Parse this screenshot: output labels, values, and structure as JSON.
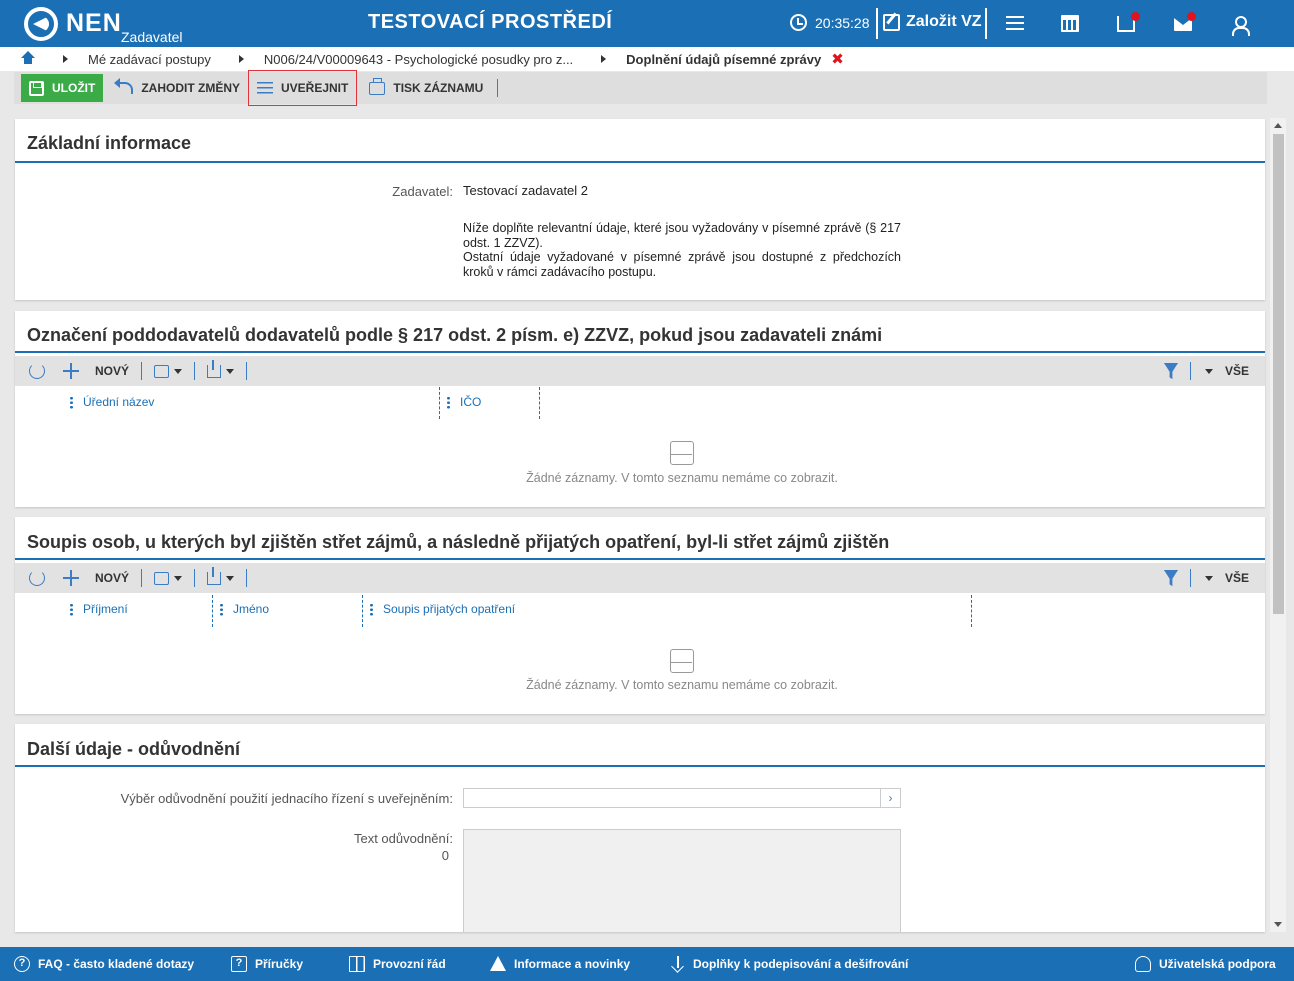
{
  "header": {
    "brand": "NEN",
    "brand_sub": "Zadavatel",
    "environment": "TESTOVACÍ PROSTŘEDÍ",
    "clock": "20:35:28",
    "create_label": "Založit VZ",
    "icons": [
      "menu-icon",
      "calendar-icon",
      "inbox-icon",
      "mail-icon",
      "user-icon"
    ],
    "accent": "#1a6fb5"
  },
  "breadcrumb": {
    "items": [
      "Mé zadávací postupy",
      "N006/24/V00009643 - Psychologické posudky pro z...",
      "Doplnění údajů písemné zprávy"
    ],
    "close": "✖"
  },
  "toolbar": {
    "save": "ULOŽIT",
    "discard": "ZAHODIT ZMĚNY",
    "publish": "UVEŘEJNIT",
    "print": "TISK ZÁZNAMU"
  },
  "basic_info": {
    "title": "Základní informace",
    "contracting_label": "Zadavatel:",
    "contracting_value": "Testovací zadavatel 2",
    "note_1": "Níže doplňte relevantní údaje, které jsou vyžadovány v písemné zprávě (§ 217 odst. 1 ZZVZ).",
    "note_2": "Ostatní údaje vyžadované v písemné zprávě jsou dostupné z předchozích kroků v rámci zadávacího postupu."
  },
  "subcontractors": {
    "title": "Označení poddodavatelů dodavatelů podle § 217 odst. 2 písm. e) ZZVZ, pokud jsou zadavateli známi",
    "new_label": "NOVÝ",
    "all_label": "VŠE",
    "columns": [
      "Úřední název",
      "IČO"
    ],
    "empty": "Žádné záznamy. V tomto seznamu nemáme co zobrazit."
  },
  "conflicts": {
    "title": "Soupis osob, u kterých byl zjištěn střet zájmů, a následně přijatých opatření, byl-li střet zájmů zjištěn",
    "new_label": "NOVÝ",
    "all_label": "VŠE",
    "columns": [
      "Příjmení",
      "Jméno",
      "Soupis přijatých opatření"
    ],
    "empty": "Žádné záznamy. V tomto seznamu nemáme co zobrazit."
  },
  "justification": {
    "title": "Další údaje - odůvodnění",
    "select_label": "Výběr odůvodnění použití jednacího řízení s uveřejněním:",
    "select_value": "",
    "text_label": "Text odůvodnění:",
    "text_count": "0"
  },
  "footer": {
    "faq": "FAQ - často kladené dotazy",
    "manuals": "Příručky",
    "rules": "Provozní řád",
    "news": "Informace a novinky",
    "addons": "Doplňky k podepisování a dešifrování",
    "support": "Uživatelská podpora"
  }
}
